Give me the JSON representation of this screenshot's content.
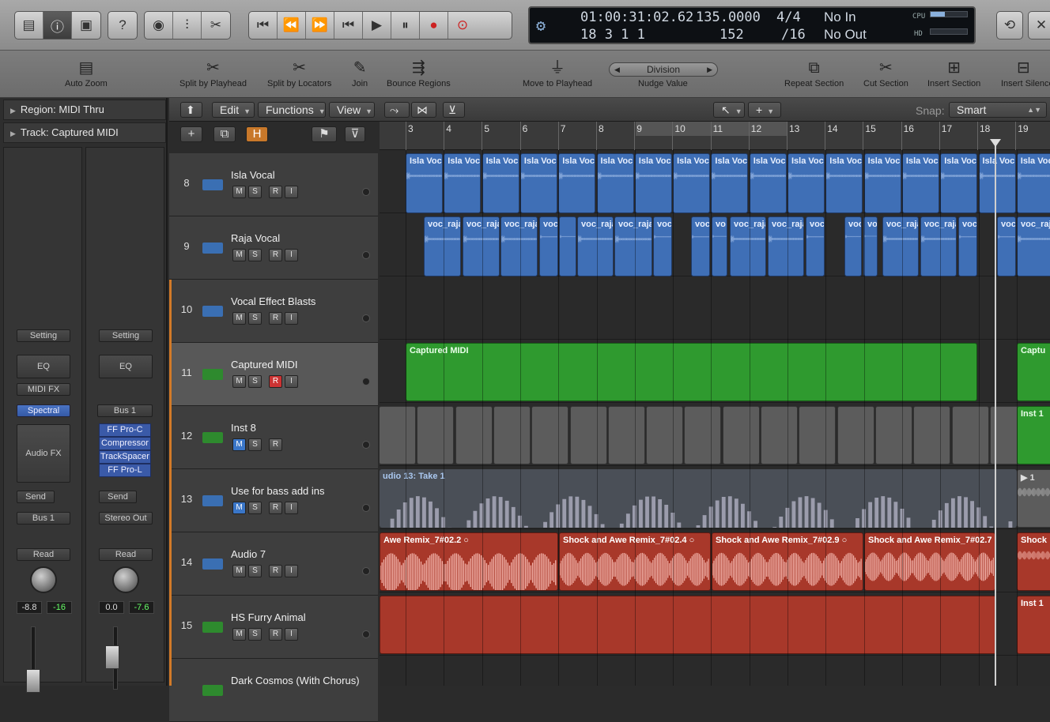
{
  "control_bar": {
    "lcd": {
      "timecode": "01:00:31:02.62",
      "position": "18  3  1    1",
      "tempo": "135.0000",
      "tempo_sub": "152",
      "signature": "4/4",
      "division": "/16",
      "midi_in": "No In",
      "midi_out": "No Out",
      "cpu_label": "CPU",
      "hd_label": "HD"
    }
  },
  "toolbar": {
    "tools": [
      {
        "label": "Auto Zoom",
        "icon": "auto-zoom-icon"
      },
      {
        "label": "Split by Playhead",
        "icon": "scissors-icon"
      },
      {
        "label": "Split by Locators",
        "icon": "scissors-locators-icon"
      },
      {
        "label": "Join",
        "icon": "glue-icon"
      },
      {
        "label": "Bounce Regions",
        "icon": "bounce-icon"
      },
      {
        "label": "Move to Playhead",
        "icon": "joystick-icon"
      },
      {
        "label": "Nudge Value",
        "icon": "nudge-icon"
      },
      {
        "label": "Repeat Section",
        "icon": "repeat-section-icon"
      },
      {
        "label": "Cut Section",
        "icon": "cut-section-icon"
      },
      {
        "label": "Insert Section",
        "icon": "insert-section-icon"
      },
      {
        "label": "Insert Silence",
        "icon": "insert-silence-icon"
      }
    ],
    "nudge_value": "Division"
  },
  "inspector": {
    "region": "Region: MIDI Thru",
    "track": "Track: Captured MIDI",
    "strip1": {
      "setting": "Setting",
      "eq": "EQ",
      "midi_fx": "MIDI FX",
      "instrument": "Spectral",
      "audio_fx": "Audio FX",
      "send": "Send",
      "output": "Bus 1",
      "automation": "Read",
      "pan": "-8.8",
      "level": "-16"
    },
    "strip2": {
      "setting": "Setting",
      "eq": "EQ",
      "input": "Bus 1",
      "plugins": [
        "FF Pro-C",
        "Compressor",
        "TrackSpacer",
        "FF Pro-L"
      ],
      "send": "Send",
      "output": "Stereo Out",
      "automation": "Read",
      "pan": "0.0",
      "level": "-7.6"
    }
  },
  "local_menu": {
    "edit": "Edit",
    "functions": "Functions",
    "view": "View",
    "snap_label": "Snap:",
    "snap_value": "Smart"
  },
  "ruler": {
    "bars": [
      "3",
      "4",
      "5",
      "6",
      "7",
      "8",
      "9",
      "10",
      "11",
      "12",
      "13",
      "14",
      "15",
      "16",
      "17",
      "18",
      "19"
    ]
  },
  "tracks": [
    {
      "num": "8",
      "name": "Isla Vocal",
      "type": "audio"
    },
    {
      "num": "9",
      "name": "Raja Vocal",
      "type": "audio"
    },
    {
      "num": "10",
      "name": "Vocal Effect Blasts",
      "type": "audio"
    },
    {
      "num": "11",
      "name": "Captured MIDI",
      "type": "midi"
    },
    {
      "num": "12",
      "name": "Inst 8",
      "type": "midi"
    },
    {
      "num": "13",
      "name": "Use for bass add ins",
      "type": "audio"
    },
    {
      "num": "14",
      "name": "Audio 7",
      "type": "audio"
    },
    {
      "num": "15",
      "name": "HS Furry Animal",
      "type": "midi"
    },
    {
      "num": "",
      "name": "Dark Cosmos (With Chorus)",
      "type": "midi"
    }
  ],
  "regions": {
    "isla_label": "Isla Voc",
    "raja_label": "voc_raja",
    "raja_short": "voc",
    "raja_vo": "vo",
    "captured": "Captured MIDI",
    "captured_short": "Captu",
    "inst1": "Inst 1",
    "audio13": "udio 13: Take 1",
    "audio13_end": "1",
    "shock": [
      "Awe Remix_7#02.2",
      "Shock and Awe Remix_7#02.4",
      "Shock and Awe Remix_7#02.9",
      "Shock and Awe Remix_7#02.7",
      "Shock"
    ]
  },
  "colors": {
    "audio_region": "#3f6fb6",
    "midi_region": "#2f9a2f",
    "red_region": "#a8382a",
    "record": "#c33"
  }
}
